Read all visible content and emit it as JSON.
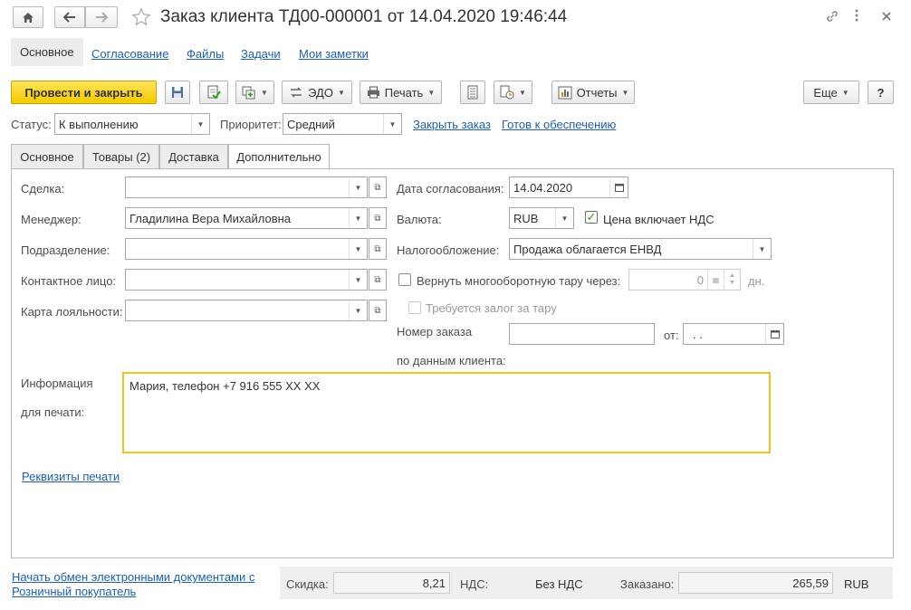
{
  "window": {
    "title": "Заказ клиента ТД00-000001 от 14.04.2020 19:46:44",
    "icons": [
      "home-icon",
      "back-icon",
      "forward-icon",
      "star-icon",
      "link-icon",
      "more-icon",
      "close-icon"
    ]
  },
  "page_links": {
    "main": "Основное",
    "approval": "Согласование",
    "files": "Файлы",
    "tasks": "Задачи",
    "notes": "Мои заметки"
  },
  "toolbar": {
    "post_close": "Провести и закрыть",
    "edo": "ЭДО",
    "print": "Печать",
    "reports": "Отчеты",
    "more": "Еще",
    "help": "?"
  },
  "status_row": {
    "status_label": "Статус:",
    "status_value": "К выполнению",
    "priority_label": "Приоритет:",
    "priority_value": "Средний",
    "close_order": "Закрыть заказ",
    "ready": "Готов к обеспечению"
  },
  "tabs": {
    "main": "Основное",
    "goods": "Товары (2)",
    "delivery": "Доставка",
    "additional": "Дополнительно"
  },
  "form": {
    "deal_label": "Сделка:",
    "deal_value": "",
    "manager_label": "Менеджер:",
    "manager_value": "Гладилина Вера Михайловна",
    "division_label": "Подразделение:",
    "division_value": "",
    "contact_label": "Контактное лицо:",
    "contact_value": "",
    "loyalty_label": "Карта лояльности:",
    "loyalty_value": "",
    "approval_date_label": "Дата согласования:",
    "approval_date_value": "14.04.2020",
    "currency_label": "Валюта:",
    "currency_value": "RUB",
    "vat_included_label": "Цена включает НДС",
    "vat_included_checked": true,
    "taxation_label": "Налогообложение:",
    "taxation_value": "Продажа облагается ЕНВД",
    "return_tare_label": "Вернуть многооборотную тару через:",
    "return_tare_days": "0",
    "days_unit": "дн.",
    "deposit_label": "Требуется залог за тару",
    "order_number_label_1": "Номер заказа",
    "order_number_label_2": "по данным клиента:",
    "order_number_value": "",
    "from_label": "от:",
    "from_value": " .  .",
    "print_info_label_1": "Информация",
    "print_info_label_2": "для печати:",
    "print_info_value": "Мария, телефон +7 916 555 XX XX",
    "print_requisites": "Реквизиты печати"
  },
  "footer": {
    "edo_link": "Начать обмен электронными документами с",
    "client_link": "Розничный покупатель",
    "discount_label": "Скидка:",
    "discount_value": "8,21",
    "vat_label": "НДС:",
    "vat_value": "Без НДС",
    "ordered_label": "Заказано:",
    "ordered_value": "265,59",
    "currency": "RUB"
  }
}
